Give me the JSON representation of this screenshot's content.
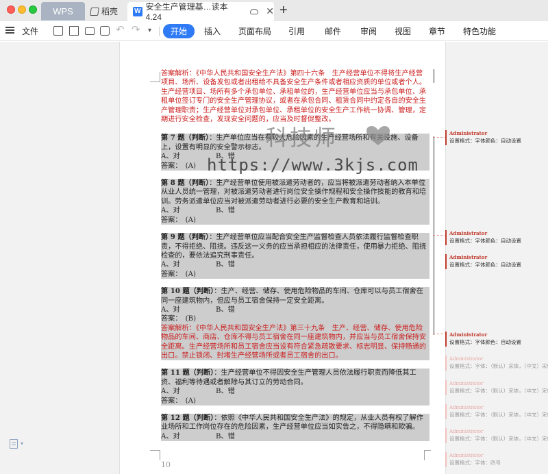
{
  "tabs": {
    "wps": "WPS",
    "docer": "稻壳",
    "doc_title": "安全生产管理基…读本 4.24",
    "doc_icon": "W"
  },
  "ribbon": {
    "file": "文件",
    "menu": [
      "开始",
      "插入",
      "页面布局",
      "引用",
      "邮件",
      "审阅",
      "视图",
      "章节",
      "特色功能"
    ]
  },
  "document": {
    "intro_explain": "答案解析：《中华人民共和国安全生产法》第四十六条　生产经营单位不得将生产经营项目、场所、设备发包或者出租给不具备安全生产条件或者相应资质的单位或者个人。生产经营项目、场所有多个承包单位、承租单位的，生产经营单位应当与承包单位、承租单位签订专门的安全生产管理协议，或者在承包合同、租赁合同中约定各自的安全生产管理职责；生产经营单位对承包单位、承租单位的安全生产工作统一协调、管理，定期进行安全检查，发现安全问题的，应当及时督促整改。",
    "questions": [
      {
        "num": "第 7 题（判断）",
        "text": "：生产单位应当在有较大危险因素的生产经营场所和有关设施、设备上，设置有明显的安全警示标志。",
        "opt_a": "A、对",
        "opt_b": "B、错",
        "answer": "答案：　(A)"
      },
      {
        "num": "第 8 题（判断）",
        "text": "：生产经营单位使用被派遣劳动者的，应当将被派遣劳动者纳入本单位从业人员统一管理，对被派遣劳动者进行岗位安全操作规程和安全操作技能的教育和培训。劳务派遣单位应当对被派遣劳动者进行必要的安全生产教育和培训。",
        "opt_a": "A、对",
        "opt_b": "B、错",
        "answer": "答案：　(A)"
      },
      {
        "num": "第 9 题（判断）",
        "text": "：生产经营单位应当配合安全生产监督检查人员依法履行监督检查职责，不得拒绝、阻挠。违反这一义务的应当承担相应的法律责任，使用暴力拒绝、阻挠检查的，要依法追究刑事责任。",
        "opt_a": "A、对",
        "opt_b": "B、错",
        "answer": "答案：　(A)"
      },
      {
        "num": "第 10 题（判断）",
        "text": "：生产、经营、储存、使用危险物品的车间、仓库可以与员工宿舍在同一座建筑物内，但应与员工宿舍保持一定安全距离。",
        "opt_a": "A、对",
        "opt_b": "B、错",
        "answer": "答案：　(B)",
        "explain": "答案解析：《中华人民共和国安全生产法》第三十九条　生产、经营、储存、使用危险物品的车间、商店、仓库不得与员工宿舍在同一座建筑物内，并应当与员工宿舍保持安全距离。生产经营场所和员工宿舍应当设有符合紧急疏散要求、标志明显、保持畅通的出口。禁止锁闭、封堵生产经营场所或者员工宿舍的出口。"
      },
      {
        "num": "第 11 题（判断）",
        "text": "：生产经营单位不得因安全生产管理人员依法履行职责而降低其工资、福利等待遇或者解除与其订立的劳动合同。",
        "opt_a": "A、对",
        "opt_b": "B、错",
        "answer": "答案：　(A)"
      },
      {
        "num": "第 12 题（判断）",
        "text": "：依照《中华人民共和国安全生产法》的规定，从业人员有权了解作业场所和工作岗位存在的危险因素，生产经营单位应当如实告之，不得隐瞒和欺骗。",
        "opt_a": "A、对",
        "opt_b": "B、错"
      }
    ],
    "page_number": "10"
  },
  "watermark": {
    "brand": "科技师",
    "url": "https://www.3kjs.com"
  },
  "comments": [
    {
      "author": "Administrator",
      "text": "设置格式：字体颜色：自动设置"
    },
    {
      "author": "Administrator",
      "text": "设置格式：字体颜色：自动设置"
    },
    {
      "author": "Administrator",
      "text": "设置格式：字体颜色：自动设置"
    },
    {
      "author": "Administrator",
      "text": "设置格式：字体颜色：自动设置"
    },
    {
      "author": "Administrator",
      "text": "设置格式：字体：（默认）宋体，（中文）宋体"
    },
    {
      "author": "Administrator",
      "text": "设置格式：字体：（默认）宋体，（中文）宋体"
    },
    {
      "author": "Administrator",
      "text": "设置格式：字体：（默认）宋体，（中文）宋体"
    },
    {
      "author": "Administrator",
      "text": "设置格式：字体：（默认）宋体，（中文）宋体"
    },
    {
      "author": "Administrator",
      "text": "设置格式：字体：四号"
    }
  ],
  "colors": {
    "accent": "#2f7bf5",
    "tracked_change": "#cc1f1f",
    "highlight": "#cdcdcd"
  }
}
